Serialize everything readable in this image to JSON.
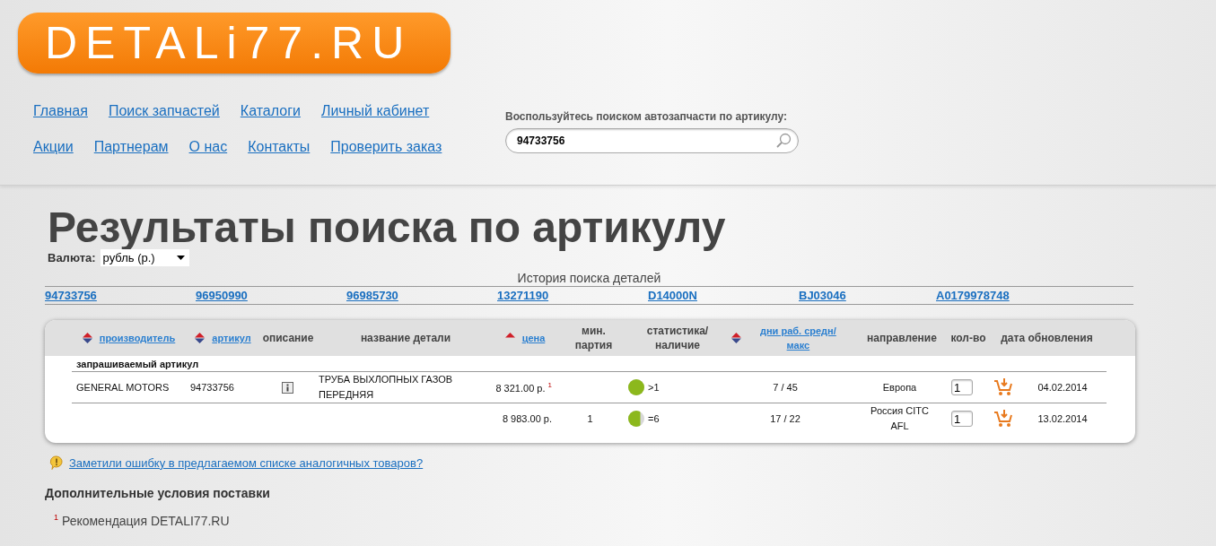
{
  "logo": "DETALi77.RU",
  "nav": [
    [
      "Главная",
      "Поиск запчастей",
      "Каталоги",
      "Личный кабинет"
    ],
    [
      "Акции",
      "Партнерам",
      "О нас",
      "Контакты",
      "Проверить заказ"
    ]
  ],
  "search": {
    "label": "Воспользуйтесь поиском автозапчасти по артикулу:",
    "value": "94733756"
  },
  "title": "Результаты поиска по артикулу",
  "currency": {
    "label": "Валюта:",
    "value": "рубль (р.)"
  },
  "history": {
    "title": "История поиска деталей",
    "items": [
      "94733756",
      "96950990",
      "96985730",
      "13271190",
      "D14000N",
      "BJ03046",
      "A0179978748"
    ]
  },
  "table": {
    "columns": [
      {
        "label": "производитель",
        "link": true,
        "sort_up": true,
        "sort_down": true
      },
      {
        "label": "артикул",
        "link": true,
        "sort_up": true,
        "sort_down": true
      },
      {
        "label": "описание",
        "link": false,
        "sort_up": false,
        "sort_down": false
      },
      {
        "label": "название детали",
        "link": false,
        "sort_up": false,
        "sort_down": false
      },
      {
        "label": "цена",
        "link": true,
        "sort_up": true,
        "sort_down": false
      },
      {
        "label": "мин. партия",
        "link": false,
        "sort_up": false,
        "sort_down": false
      },
      {
        "label": "статистика/ наличие",
        "link": false,
        "sort_up": false,
        "sort_down": false
      },
      {
        "label": "дни раб. средн/ макс",
        "link": true,
        "sort_up": true,
        "sort_down": true
      },
      {
        "label": "направление",
        "link": false,
        "sort_up": false,
        "sort_down": false
      },
      {
        "label": "кол-во",
        "link": false,
        "sort_up": false,
        "sort_down": false
      },
      {
        "label": "дата обновления",
        "link": false,
        "sort_up": false,
        "sort_down": false
      }
    ],
    "group": "запрашиваемый артикул",
    "rows": [
      {
        "manufacturer": "GENERAL MOTORS",
        "article": "94733756",
        "info": true,
        "name": "ТРУБА ВЫХЛОПНЫХ ГАЗОВ ПЕРЕДНЯЯ",
        "price": "8 321.00 р. $^{1}$",
        "min": "",
        "stock": {
          "level": 1,
          "text": ">1"
        },
        "days": "7 / 45",
        "direction": "Европа",
        "qty": "1",
        "date": "04.02.2014"
      },
      {
        "manufacturer": "",
        "article": "",
        "info": false,
        "name": "",
        "price": "8 983.00 р.",
        "min": "1",
        "stock": {
          "level": 0.75,
          "text": "=6"
        },
        "days": "17 / 22",
        "direction": "Россия СІТС AFL",
        "qty": "1",
        "date": "13.02.2014"
      }
    ]
  },
  "report_link": "Заметили ошибку в предлагаемом списке аналогичных товаров?",
  "conditions": {
    "title": "Дополнительные условия поставки",
    "notes": [
      "$^{1}$ Рекомендация DETALI77.RU"
    ]
  }
}
